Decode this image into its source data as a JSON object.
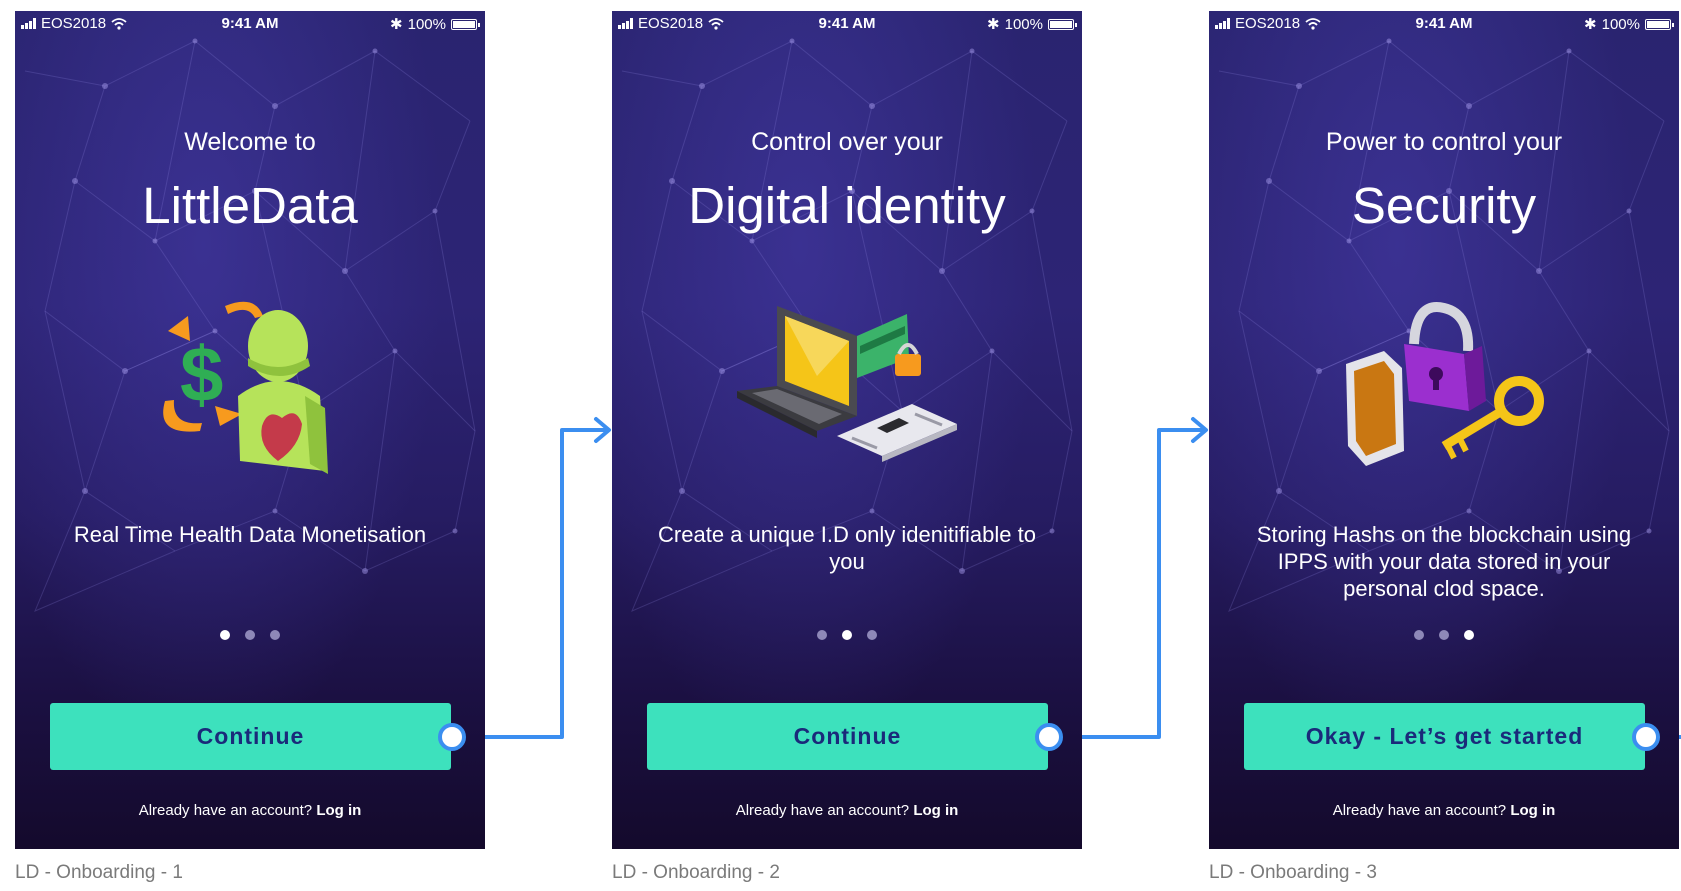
{
  "status_bar": {
    "carrier": "EOS2018",
    "time": "9:41 AM",
    "battery": "100%"
  },
  "screens": [
    {
      "subtitle": "Welcome to",
      "title": "LittleData",
      "description": "Real Time Health Data Monetisation",
      "illustration": "money-exchange-user-heart-icon",
      "page_index": 1,
      "page_count": 3,
      "button": "Continue",
      "account_prompt": "Already have an account?",
      "login_link": "Log in",
      "caption": "LD - Onboarding - 1"
    },
    {
      "subtitle": "Control over your",
      "title": "Digital identity",
      "description": "Create a unique I.D only idenitifiable to you",
      "illustration": "laptop-card-id-icon",
      "page_index": 2,
      "page_count": 3,
      "button": "Continue",
      "account_prompt": "Already have an account?",
      "login_link": "Log in",
      "caption": "LD - Onboarding - 2"
    },
    {
      "subtitle": "Power to control your",
      "title": "Security",
      "description": "Storing Hashs on the blockchain using IPPS with your data stored in your personal clod space.",
      "illustration": "shield-padlock-key-icon",
      "page_index": 3,
      "page_count": 3,
      "button": "Okay - Let’s get started",
      "account_prompt": "Already have an account?",
      "login_link": "Log in",
      "caption": "LD - Onboarding - 3"
    }
  ],
  "colors": {
    "background_top": "#2a2470",
    "background_bottom": "#140a2c",
    "button": "#3de1bd",
    "button_text": "#1a2a7a",
    "flow_connector": "#3b8ef0"
  }
}
